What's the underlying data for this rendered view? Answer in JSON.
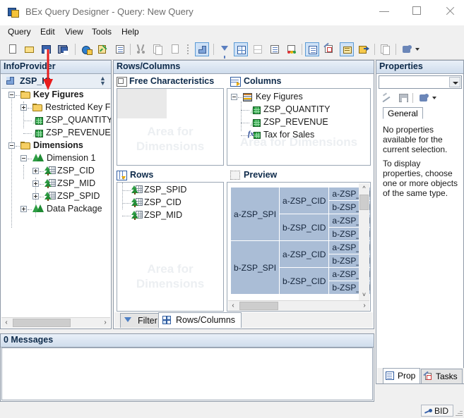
{
  "window": {
    "title": "BEx Query Designer - Query: New Query",
    "app_icon": "bex-app-icon",
    "minimize": "minimize-icon",
    "maximize": "maximize-icon",
    "close": "close-icon"
  },
  "menubar": {
    "items": [
      {
        "label": "Query"
      },
      {
        "label": "Edit"
      },
      {
        "label": "View"
      },
      {
        "label": "Tools"
      },
      {
        "label": "Help"
      }
    ]
  },
  "toolbar": {
    "buttons": [
      {
        "name": "new-query-icon",
        "tip": "New"
      },
      {
        "name": "open-query-icon",
        "tip": "Open"
      },
      {
        "name": "save-query-icon",
        "tip": "Save"
      },
      {
        "name": "save-as-icon",
        "tip": "Save As"
      },
      {
        "name": "publish-icon",
        "tip": "Publish"
      },
      {
        "name": "check-query-icon",
        "tip": "Check"
      },
      {
        "name": "query-properties-icon",
        "tip": "Query Properties"
      },
      {
        "name": "cut-icon",
        "tip": "Cut"
      },
      {
        "name": "copy-icon",
        "tip": "Copy"
      },
      {
        "name": "paste-icon",
        "tip": "Paste"
      },
      {
        "name": "infoprovider-icon",
        "tip": "InfoProvider"
      },
      {
        "name": "filter-icon",
        "tip": "Filter"
      },
      {
        "name": "rows-columns-icon",
        "tip": "Rows/Columns"
      },
      {
        "name": "cell-definition-icon",
        "tip": "Cells"
      },
      {
        "name": "conditions-icon",
        "tip": "Conditions"
      },
      {
        "name": "exceptions-icon",
        "tip": "Exceptions"
      },
      {
        "name": "properties-icon",
        "tip": "Properties"
      },
      {
        "name": "tasks-icon",
        "tip": "Tasks"
      },
      {
        "name": "messages-icon",
        "tip": "Messages"
      },
      {
        "name": "where-used-icon",
        "tip": "Where-Used List"
      },
      {
        "name": "documents-icon",
        "tip": "Documents"
      },
      {
        "name": "settings-icon",
        "tip": "Settings"
      }
    ]
  },
  "infoprovider": {
    "title": "InfoProvider",
    "selected": "ZSP_IC",
    "tree": [
      {
        "label": "Key Figures",
        "icon": "folder-icon",
        "indent": 0,
        "expander": "minus",
        "bold": true
      },
      {
        "label": "Restricted Key Fig",
        "icon": "folder-icon",
        "indent": 1,
        "expander": "plus",
        "bold": false
      },
      {
        "label": "ZSP_QUANTITY",
        "icon": "key-figure-icon",
        "indent": 2,
        "expander": "none",
        "bold": false
      },
      {
        "label": "ZSP_REVENUE",
        "icon": "key-figure-icon",
        "indent": 2,
        "expander": "none",
        "bold": false
      },
      {
        "label": "Dimensions",
        "icon": "folder-icon",
        "indent": 0,
        "expander": "minus",
        "bold": true
      },
      {
        "label": "Dimension 1",
        "icon": "dimension-icon",
        "indent": 1,
        "expander": "minus",
        "bold": false
      },
      {
        "label": "ZSP_CID",
        "icon": "characteristic-icon",
        "indent": 2,
        "expander": "plus",
        "bold": false
      },
      {
        "label": "ZSP_MID",
        "icon": "characteristic-icon",
        "indent": 2,
        "expander": "plus",
        "bold": false
      },
      {
        "label": "ZSP_SPID",
        "icon": "characteristic-icon",
        "indent": 2,
        "expander": "plus",
        "bold": false
      },
      {
        "label": "Data Package",
        "icon": "dimension-icon",
        "indent": 1,
        "expander": "plus",
        "bold": false
      }
    ]
  },
  "rows_columns": {
    "title": "Rows/Columns",
    "free_characteristics": {
      "title": "Free Characteristics",
      "icon": "free-characteristics-icon",
      "watermark": "Area for Dimensions",
      "items": []
    },
    "columns": {
      "title": "Columns",
      "icon": "columns-icon",
      "watermark": "Area for Dimensions",
      "root": {
        "label": "Key Figures",
        "icon": "key-figure-structure-icon",
        "expander": "minus"
      },
      "items": [
        {
          "label": "ZSP_QUANTITY",
          "icon": "key-figure-icon"
        },
        {
          "label": "ZSP_REVENUE",
          "icon": "key-figure-icon"
        },
        {
          "label": "Tax for Sales",
          "icon": "formula-icon"
        }
      ]
    },
    "rows": {
      "title": "Rows",
      "icon": "rows-icon",
      "watermark": "Area for Dimensions",
      "items": [
        {
          "label": "ZSP_SPID",
          "icon": "characteristic-icon"
        },
        {
          "label": "ZSP_CID",
          "icon": "characteristic-icon"
        },
        {
          "label": "ZSP_MID",
          "icon": "characteristic-icon"
        }
      ]
    },
    "preview": {
      "title": "Preview",
      "icon": "preview-icon",
      "rows": [
        {
          "col1": "a-ZSP_SPI",
          "col1_span": 4,
          "col2": "a-ZSP_CID",
          "col2_span": 2,
          "col3": "a-ZSP_MID"
        },
        {
          "col3": "b-ZSP_MID"
        },
        {
          "col2": "b-ZSP_CID",
          "col2_span": 2,
          "col3": "a-ZSP_MID"
        },
        {
          "col3": "b-ZSP_MID"
        },
        {
          "col1": "b-ZSP_SPI",
          "col1_span": 4,
          "col2": "a-ZSP_CID",
          "col2_span": 2,
          "col3": "a-ZSP_MID"
        },
        {
          "col3": "b-ZSP_MID"
        },
        {
          "col2": "b-ZSP_CID",
          "col2_span": 2,
          "col3": "a-ZSP_MID"
        },
        {
          "col3": "b-ZSP_MID"
        }
      ]
    },
    "tabs": [
      {
        "label": "Filter",
        "icon": "filter-icon",
        "active": false
      },
      {
        "label": "Rows/Columns",
        "icon": "rows-columns-icon",
        "active": true
      }
    ]
  },
  "properties": {
    "title": "Properties",
    "combo_value": "",
    "tab": "General",
    "paragraph1": "No properties available for the current selection.",
    "paragraph2": "To display properties, choose one or more objects of the same type.",
    "toolbar": [
      {
        "name": "edit-properties-icon"
      },
      {
        "name": "save-properties-icon"
      },
      {
        "name": "properties-settings-icon"
      }
    ],
    "bottom_tabs": [
      {
        "label": "Prop",
        "icon": "properties-icon",
        "active": true
      },
      {
        "label": "Tasks",
        "icon": "tasks-icon",
        "active": false
      }
    ]
  },
  "messages": {
    "title": "0 Messages",
    "items": []
  },
  "statusbar": {
    "system": "BID",
    "icon": "connection-icon"
  },
  "annotation": {
    "arrow_color": "#e81c1c",
    "target": "save-query-icon"
  },
  "colors": {
    "panel_header_top": "#e9f0f8",
    "panel_header_bottom": "#cfdcec",
    "preview_cell": "#aabdd6",
    "selection_blue": "#cfe2f7",
    "watermark": "#eceff2"
  }
}
